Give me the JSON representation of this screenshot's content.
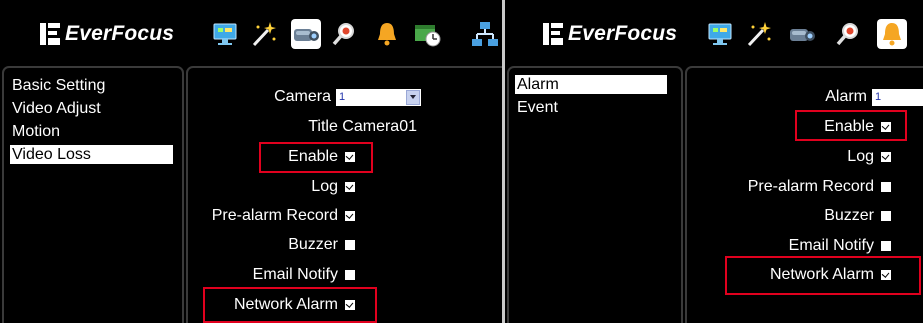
{
  "brand": "EverFocus",
  "left_screen": {
    "toolbar": [
      "monitor-icon",
      "magic-wand-icon",
      "camera-icon",
      "search-icon",
      "bell-icon",
      "schedule-icon",
      "network-icon"
    ],
    "selected_tool": "camera-icon",
    "menu": [
      "Basic Setting",
      "Video Adjust",
      "Motion",
      "Video Loss"
    ],
    "selected_menu": "Video Loss",
    "camera_label": "Camera",
    "camera_value": "1",
    "title_label": "Title",
    "title_value": "Camera01",
    "options": [
      {
        "label": "Enable",
        "checked": true,
        "highlighted": true
      },
      {
        "label": "Log",
        "checked": true,
        "highlighted": false
      },
      {
        "label": "Pre-alarm Record",
        "checked": true,
        "highlighted": false
      },
      {
        "label": "Buzzer",
        "checked": false,
        "highlighted": false
      },
      {
        "label": "Email Notify",
        "checked": false,
        "highlighted": false
      },
      {
        "label": "Network Alarm",
        "checked": true,
        "highlighted": true
      }
    ]
  },
  "right_screen": {
    "toolbar": [
      "monitor-icon",
      "magic-wand-icon",
      "camera-icon",
      "search-icon",
      "bell-icon"
    ],
    "selected_tool": "bell-icon",
    "menu": [
      "Alarm",
      "Event"
    ],
    "selected_menu": "Alarm",
    "alarm_label": "Alarm",
    "alarm_value": "1",
    "options": [
      {
        "label": "Enable",
        "checked": true,
        "highlighted": true
      },
      {
        "label": "Log",
        "checked": true,
        "highlighted": false
      },
      {
        "label": "Pre-alarm Record",
        "checked": false,
        "highlighted": false
      },
      {
        "label": "Buzzer",
        "checked": false,
        "highlighted": false
      },
      {
        "label": "Email Notify",
        "checked": false,
        "highlighted": false
      },
      {
        "label": "Network Alarm",
        "checked": true,
        "highlighted": true
      }
    ]
  },
  "colors": {
    "highlight": "#e1001e",
    "panel_bg": "#000000",
    "text": "#ffffff"
  }
}
